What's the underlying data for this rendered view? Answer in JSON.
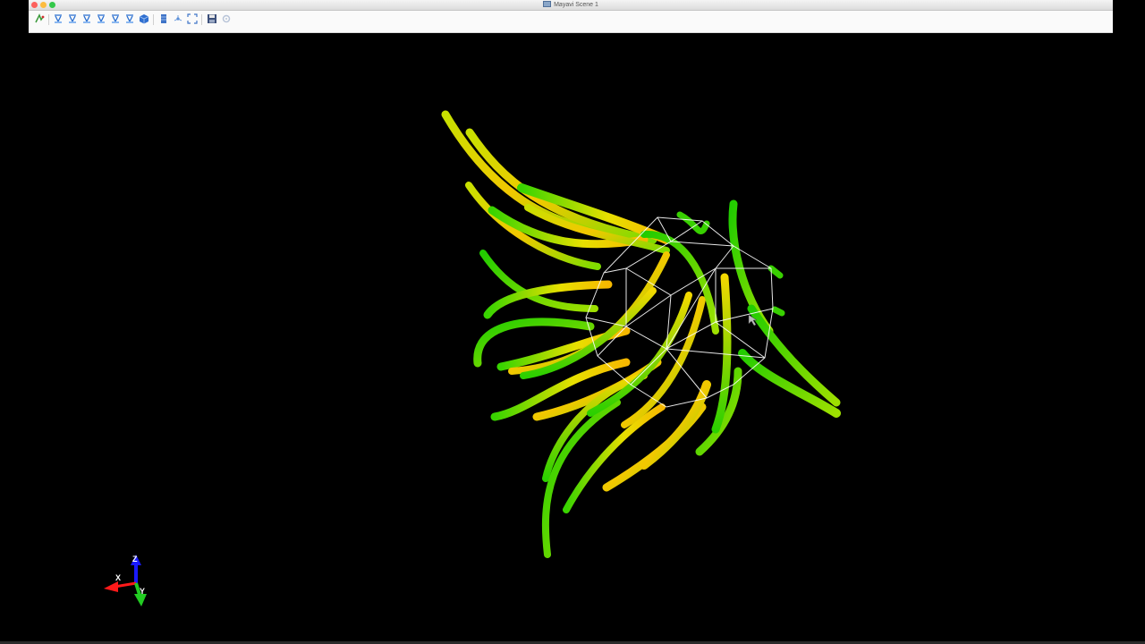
{
  "window": {
    "title": "Mayavi Scene 1",
    "traffic_lights": {
      "close": "#fc605c",
      "minimize": "#fdbc40",
      "zoom": "#34c84a"
    }
  },
  "toolbar": {
    "buttons": [
      {
        "name": "mayavi-pipeline-button",
        "icon": "mayavi-icon"
      },
      {
        "name": "view-x-plus-button",
        "icon": "axis-view-icon"
      },
      {
        "name": "view-x-minus-button",
        "icon": "axis-view-icon"
      },
      {
        "name": "view-y-plus-button",
        "icon": "axis-view-icon"
      },
      {
        "name": "view-y-minus-button",
        "icon": "axis-view-icon"
      },
      {
        "name": "view-z-plus-button",
        "icon": "axis-view-icon"
      },
      {
        "name": "view-z-minus-button",
        "icon": "axis-view-icon"
      },
      {
        "name": "isometric-view-button",
        "icon": "cube-icon"
      },
      {
        "name": "parallel-projection-button",
        "icon": "projection-icon"
      },
      {
        "name": "axes-indicator-button",
        "icon": "axes-icon"
      },
      {
        "name": "fullscreen-button",
        "icon": "fullscreen-icon"
      },
      {
        "name": "save-scene-button",
        "icon": "save-icon"
      },
      {
        "name": "configure-scene-button",
        "icon": "settings-icon"
      }
    ]
  },
  "scene": {
    "background": "#000000",
    "wireframe_color": "#ffffff",
    "streamline_colors": [
      "#22d000",
      "#8fe000",
      "#d4e000",
      "#f2d000",
      "#f6a500"
    ]
  },
  "axes": {
    "z_label": "Z",
    "x_label": "X",
    "y_label": "Y",
    "z_color": "#1a1aff",
    "x_color": "#ff1a1a",
    "y_color": "#22cc22"
  }
}
